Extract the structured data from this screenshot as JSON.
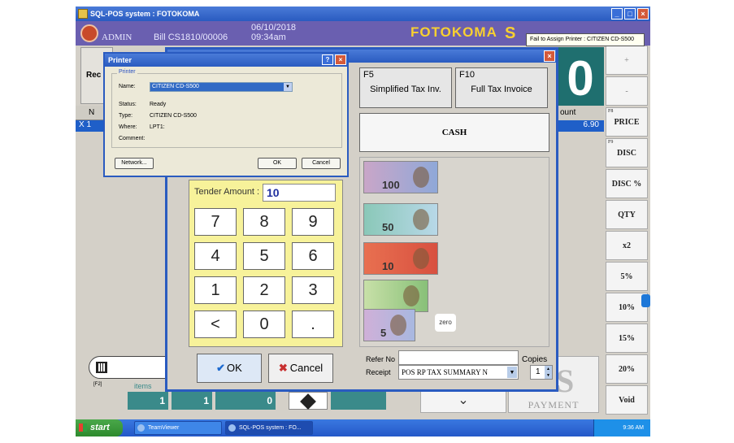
{
  "app": {
    "title": "SQL-POS system : FOTOKOMA"
  },
  "header": {
    "user": "ADMIN",
    "bill": "Bill  CS1810/00006",
    "date": "06/10/2018",
    "time": "09:34am",
    "brand": "FOTOKOMA",
    "brand_tail": "S"
  },
  "tooltip": "Fail to Assign Printer : CITIZEN CD-S500",
  "background": {
    "left_button": "Rec",
    "grid_header": "N",
    "grid_row": "X  1",
    "amount_header": "ount",
    "amount_value": "6.90",
    "big_display": "0"
  },
  "right_buttons": [
    {
      "label": "+",
      "fkey": ""
    },
    {
      "label": "-",
      "fkey": ""
    },
    {
      "label": "PRICE",
      "fkey": "F8"
    },
    {
      "label": "DISC",
      "fkey": "F9"
    },
    {
      "label": "DISC %",
      "fkey": ""
    },
    {
      "label": "QTY",
      "fkey": ""
    },
    {
      "label": "x2",
      "fkey": ""
    },
    {
      "label": "5%",
      "fkey": ""
    },
    {
      "label": "10%",
      "fkey": ""
    },
    {
      "label": "15%",
      "fkey": ""
    },
    {
      "label": "20%",
      "fkey": ""
    },
    {
      "label": "Void",
      "fkey": ""
    }
  ],
  "bottom": {
    "f2": "[F2]",
    "items_label": "items",
    "counts": [
      "1",
      "1",
      "0"
    ],
    "chevron": "⌄",
    "payment": "PAYMENT",
    "payment_big": "S"
  },
  "payment_dialog": {
    "tiles": [
      {
        "key": "F5",
        "label": "Simplified Tax Inv."
      },
      {
        "key": "F10",
        "label": "Full Tax Invoice"
      }
    ],
    "cash": "CASH",
    "tender_label": "Tender Amount :",
    "tender_value": "10",
    "keys": [
      "7",
      "8",
      "9",
      "4",
      "5",
      "6",
      "1",
      "2",
      "3",
      "<",
      "0",
      "."
    ],
    "ok": "OK",
    "cancel": "Cancel",
    "notes": [
      "100",
      "50",
      "10",
      "",
      "5"
    ],
    "zero": "zero",
    "refno_label": "Refer No",
    "receipt_label": "Receipt",
    "receipt_value": "POS RP TAX SUMMARY N",
    "copies_label": "Copies",
    "copies_value": "1"
  },
  "printer_dialog": {
    "title": "Printer",
    "group": "Printer",
    "name_label": "Name:",
    "name_value": "CITIZEN CD-S500",
    "status_label": "Status:",
    "status_value": "Ready",
    "type_label": "Type:",
    "type_value": "CITIZEN CD-S500",
    "where_label": "Where:",
    "where_value": "LPT1:",
    "comment_label": "Comment:",
    "network": "Network...",
    "ok": "OK",
    "cancel": "Cancel"
  },
  "taskbar": {
    "start": "start",
    "tasks": [
      "TeamViewer",
      "SQL-POS system : FO..."
    ],
    "clock": "9:36 AM"
  },
  "colors": {
    "titlebar": "#2a5bc0",
    "keypad": "#f7f29a",
    "accent_teal": "#3a8a8a",
    "brand": "#f8d030"
  }
}
